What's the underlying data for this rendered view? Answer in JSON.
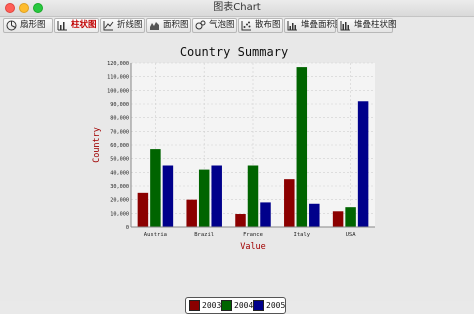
{
  "window": {
    "title": "图表Chart"
  },
  "tabs": [
    {
      "label": "扇形图",
      "icon": "pie-chart-icon",
      "active": false
    },
    {
      "label": "柱状图",
      "icon": "bar-chart-icon",
      "active": true
    },
    {
      "label": "折线图",
      "icon": "line-chart-icon",
      "active": false
    },
    {
      "label": "面积图",
      "icon": "area-chart-icon",
      "active": false
    },
    {
      "label": "气泡图",
      "icon": "bubble-chart-icon",
      "active": false
    },
    {
      "label": "散布图",
      "icon": "scatter-chart-icon",
      "active": false
    },
    {
      "label": "堆叠面积图",
      "icon": "stacked-area-chart-icon",
      "active": false
    },
    {
      "label": "堆叠柱状图",
      "icon": "stacked-bar-chart-icon",
      "active": false
    }
  ],
  "colors": {
    "title_label": "#a00000",
    "series": [
      "#8b0000",
      "#006400",
      "#00008b"
    ],
    "plot_bg": "#f4f4f4",
    "grid": "#cfcfcf"
  },
  "chart_data": {
    "type": "bar",
    "title": "Country Summary",
    "xlabel": "Value",
    "ylabel": "Country",
    "categories": [
      "Austria",
      "Brazil",
      "France",
      "Italy",
      "USA"
    ],
    "series": [
      {
        "name": "2003",
        "values": [
          25000,
          20000,
          9500,
          35000,
          11500
        ]
      },
      {
        "name": "2004",
        "values": [
          57000,
          42000,
          45000,
          117000,
          14500
        ]
      },
      {
        "name": "2005",
        "values": [
          45000,
          45000,
          18000,
          17000,
          92000
        ]
      }
    ],
    "ylim": [
      0,
      120000
    ],
    "yticks": [
      "0",
      "10,000",
      "20,000",
      "30,000",
      "40,000",
      "50,000",
      "60,000",
      "70,000",
      "80,000",
      "90,000",
      "100,000",
      "110,000",
      "120,000"
    ],
    "grid": true,
    "legend_position": "bottom"
  }
}
